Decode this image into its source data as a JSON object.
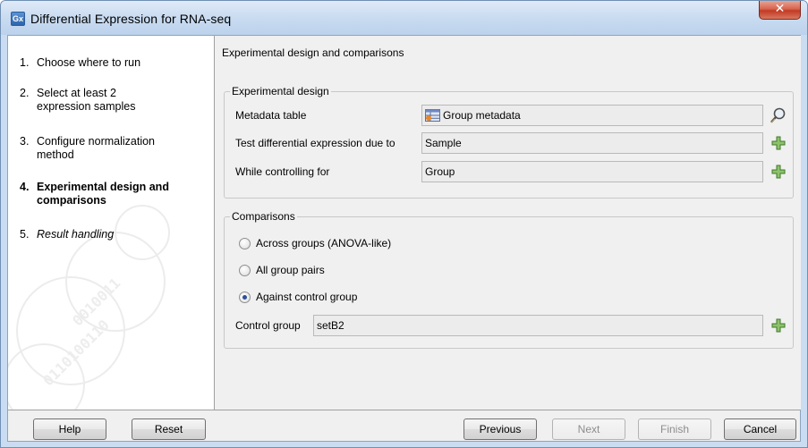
{
  "window": {
    "title": "Differential Expression for RNA-seq",
    "app_icon": "Gx",
    "close_icon": "close-icon"
  },
  "steps": [
    {
      "num": "1.",
      "label": "Choose where to run"
    },
    {
      "num": "2.",
      "label": "Select at least 2 expression samples"
    },
    {
      "num": "3.",
      "label": "Configure normalization method"
    },
    {
      "num": "4.",
      "label": "Experimental design and comparisons"
    },
    {
      "num": "5.",
      "label": "Result handling"
    }
  ],
  "main": {
    "section_title": "Experimental design and comparisons",
    "experimental_design": {
      "legend": "Experimental design",
      "metadata_label": "Metadata table",
      "metadata_value": "Group metadata",
      "test_label": "Test differential expression due to",
      "test_value": "Sample",
      "control_label": "While controlling for",
      "control_value": "Group"
    },
    "comparisons": {
      "legend": "Comparisons",
      "options": [
        {
          "label": "Across groups (ANOVA-like)",
          "checked": false
        },
        {
          "label": "All group pairs",
          "checked": false
        },
        {
          "label": "Against control group",
          "checked": true
        }
      ],
      "control_group_label": "Control group",
      "control_group_value": "setB2"
    }
  },
  "footer": {
    "help": "Help",
    "reset": "Reset",
    "previous": "Previous",
    "next": "Next",
    "finish": "Finish",
    "cancel": "Cancel"
  },
  "colors": {
    "title_bar": "#c7daf0",
    "close_button": "#c23a23",
    "plus_icon": "#5a9a3a",
    "selected_radio": "#2b4f9e"
  }
}
